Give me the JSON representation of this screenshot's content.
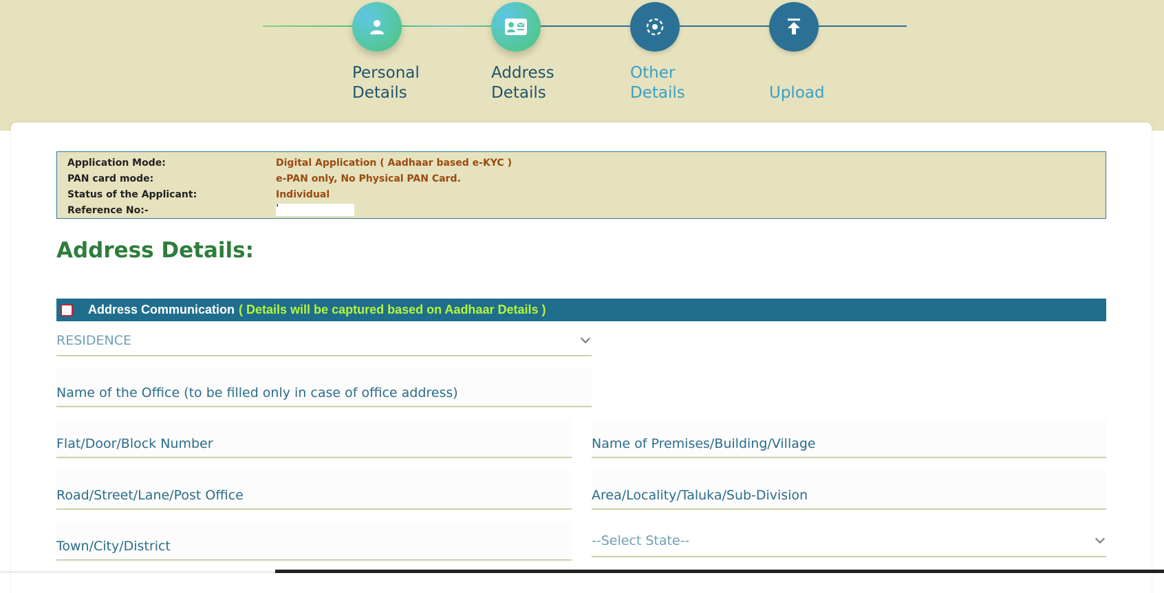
{
  "steps": [
    {
      "label_line1": "Personal",
      "label_line2": "Details",
      "icon": "person-icon",
      "status": "completed"
    },
    {
      "label_line1": "Address",
      "label_line2": "Details",
      "icon": "id-card-icon",
      "status": "current"
    },
    {
      "label_line1": "Other",
      "label_line2": "Details",
      "icon": "dashed-circle-icon",
      "status": "pending"
    },
    {
      "label_line1": "",
      "label_line2": "Upload",
      "icon": "upload-icon",
      "status": "pending"
    }
  ],
  "info": {
    "mode_key": "Application Mode:",
    "mode_val": "Digital Application ( Aadhaar based e-KYC )",
    "pan_key": "PAN card mode:",
    "pan_val": "e-PAN only, No Physical PAN Card.",
    "status_key": "Status of the Applicant:",
    "status_val": "Individual",
    "ref_key": "Reference No:-",
    "ref_val": "'"
  },
  "section_title": "Address Details:",
  "communication": {
    "title": "Address Communication",
    "note": "( Details will be captured based on Aadhaar Details )",
    "checked": false
  },
  "form": {
    "address_type": "RESIDENCE",
    "office_name": "Name of the Office (to be filled only in case of office address)",
    "flat": "Flat/Door/Block Number",
    "premises": "Name of Premises/Building/Village",
    "road": "Road/Street/Lane/Post Office",
    "area": "Area/Locality/Taluka/Sub-Division",
    "town": "Town/City/District",
    "state": "--Select State--"
  },
  "colors": {
    "background_band": "#e6e2bd",
    "step_pending": "#2b7195",
    "section_title": "#2e7d3c",
    "comm_bar": "#1f6e8d",
    "comm_note": "#b8f53a",
    "info_value": "#9a4a12"
  }
}
